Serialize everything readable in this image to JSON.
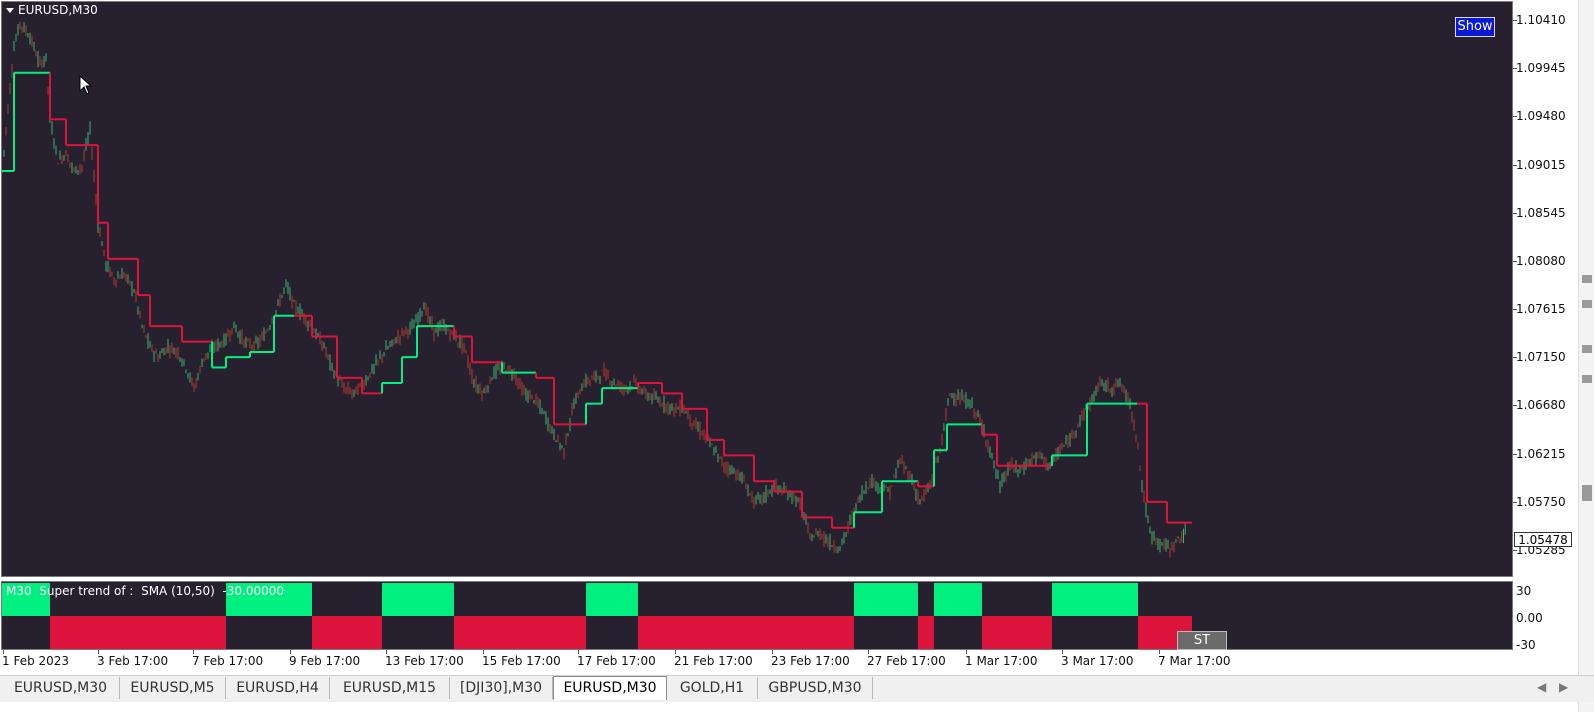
{
  "window": {
    "title": "EURUSD,M30",
    "show_button": "Show",
    "indicator_label": "M30  Super trend of :  SMA (10,50)  -30.00000",
    "st_button": "ST"
  },
  "price_axis": [
    "1.10410",
    "1.09945",
    "1.09480",
    "1.09015",
    "1.08545",
    "1.08080",
    "1.07615",
    "1.07150",
    "1.06680",
    "1.06215",
    "1.05750",
    "1.05285"
  ],
  "current_price": "1.05478",
  "sub_axis": [
    "30",
    "0.00",
    "-30"
  ],
  "time_axis": [
    "1 Feb 2023",
    "3 Feb 17:00",
    "7 Feb 17:00",
    "9 Feb 17:00",
    "13 Feb 17:00",
    "15 Feb 17:00",
    "17 Feb 17:00",
    "21 Feb 17:00",
    "23 Feb 17:00",
    "27 Feb 17:00",
    "1 Mar 17:00",
    "3 Mar 17:00",
    "7 Mar 17:00"
  ],
  "tabs": [
    {
      "label": "EURUSD,M30",
      "active": false
    },
    {
      "label": "EURUSD,M5",
      "active": false
    },
    {
      "label": "EURUSD,H4",
      "active": false
    },
    {
      "label": "EURUSD,M15",
      "active": false
    },
    {
      "label": "[DJI30],M30",
      "active": false
    },
    {
      "label": "EURUSD,M30",
      "active": true
    },
    {
      "label": "GOLD,H1",
      "active": false
    },
    {
      "label": "GBPUSD,M30",
      "active": false
    }
  ],
  "colors": {
    "background": "#27212f",
    "bull": "#00f080",
    "bear": "#dc143c",
    "candle_up": "#3cb371",
    "candle_down": "#b03a2e"
  },
  "chart_data": {
    "type": "line",
    "series": [
      {
        "values": [
          [
            0,
            1.0895
          ],
          [
            12,
            1.1015
          ],
          [
            18,
            1.1038
          ],
          [
            28,
            1.1025
          ],
          [
            38,
            1.0998
          ],
          [
            44,
            1.1005
          ],
          [
            48,
            1.0945
          ],
          [
            56,
            1.0905
          ],
          [
            64,
            1.0912
          ],
          [
            72,
            1.0895
          ],
          [
            80,
            1.09
          ],
          [
            88,
            1.0935
          ],
          [
            96,
            1.0845
          ],
          [
            104,
            1.0805
          ],
          [
            112,
            1.079
          ],
          [
            122,
            1.0795
          ],
          [
            132,
            1.078
          ],
          [
            140,
            1.0745
          ],
          [
            148,
            1.0725
          ],
          [
            156,
            1.0715
          ],
          [
            166,
            1.0725
          ],
          [
            176,
            1.072
          ],
          [
            184,
            1.0705
          ],
          [
            192,
            1.0685
          ],
          [
            202,
            1.0715
          ],
          [
            212,
            1.0725
          ],
          [
            222,
            1.073
          ],
          [
            232,
            1.0745
          ],
          [
            242,
            1.073
          ],
          [
            252,
            1.0725
          ],
          [
            262,
            1.0735
          ],
          [
            272,
            1.0755
          ],
          [
            284,
            1.0785
          ],
          [
            292,
            1.0765
          ],
          [
            302,
            1.0755
          ],
          [
            312,
            1.074
          ],
          [
            322,
            1.0725
          ],
          [
            332,
            1.07
          ],
          [
            342,
            1.0685
          ],
          [
            352,
            1.068
          ],
          [
            362,
            1.069
          ],
          [
            372,
            1.0705
          ],
          [
            382,
            1.072
          ],
          [
            392,
            1.073
          ],
          [
            402,
            1.074
          ],
          [
            412,
            1.0745
          ],
          [
            422,
            1.0765
          ],
          [
            432,
            1.074
          ],
          [
            442,
            1.0745
          ],
          [
            452,
            1.0735
          ],
          [
            462,
            1.0725
          ],
          [
            472,
            1.069
          ],
          [
            482,
            1.068
          ],
          [
            492,
            1.07
          ],
          [
            502,
            1.0705
          ],
          [
            512,
            1.07
          ],
          [
            522,
            1.068
          ],
          [
            532,
            1.0675
          ],
          [
            542,
            1.066
          ],
          [
            552,
            1.064
          ],
          [
            562,
            1.0625
          ],
          [
            572,
            1.067
          ],
          [
            582,
            1.069
          ],
          [
            592,
            1.0695
          ],
          [
            602,
            1.07
          ],
          [
            612,
            1.069
          ],
          [
            622,
            1.0685
          ],
          [
            632,
            1.069
          ],
          [
            642,
            1.068
          ],
          [
            652,
            1.0675
          ],
          [
            662,
            1.067
          ],
          [
            672,
            1.0665
          ],
          [
            682,
            1.0665
          ],
          [
            692,
            1.065
          ],
          [
            702,
            1.064
          ],
          [
            712,
            1.0625
          ],
          [
            722,
            1.061
          ],
          [
            732,
            1.0605
          ],
          [
            742,
            1.0595
          ],
          [
            752,
            1.0575
          ],
          [
            762,
            1.058
          ],
          [
            772,
            1.059
          ],
          [
            782,
            1.0585
          ],
          [
            792,
            1.058
          ],
          [
            800,
            1.057
          ],
          [
            808,
            1.054
          ],
          [
            818,
            1.0545
          ],
          [
            828,
            1.0535
          ],
          [
            838,
            1.053
          ],
          [
            848,
            1.0555
          ],
          [
            858,
            1.058
          ],
          [
            868,
            1.0595
          ],
          [
            878,
            1.059
          ],
          [
            888,
            1.0585
          ],
          [
            898,
            1.0615
          ],
          [
            908,
            1.06
          ],
          [
            918,
            1.0575
          ],
          [
            928,
            1.059
          ],
          [
            938,
            1.0625
          ],
          [
            948,
            1.068
          ],
          [
            958,
            1.0675
          ],
          [
            968,
            1.067
          ],
          [
            978,
            1.0655
          ],
          [
            988,
            1.0625
          ],
          [
            998,
            1.059
          ],
          [
            1008,
            1.061
          ],
          [
            1018,
            1.0605
          ],
          [
            1028,
            1.0615
          ],
          [
            1038,
            1.062
          ],
          [
            1048,
            1.061
          ],
          [
            1058,
            1.0625
          ],
          [
            1068,
            1.0635
          ],
          [
            1078,
            1.0655
          ],
          [
            1088,
            1.067
          ],
          [
            1098,
            1.069
          ],
          [
            1108,
            1.0685
          ],
          [
            1118,
            1.069
          ],
          [
            1128,
            1.067
          ],
          [
            1136,
            1.063
          ],
          [
            1140,
            1.059
          ],
          [
            1148,
            1.0545
          ],
          [
            1158,
            1.0535
          ],
          [
            1168,
            1.053
          ],
          [
            1178,
            1.054
          ],
          [
            1185,
            1.0548
          ]
        ]
      }
    ],
    "supertrend": [
      {
        "from": 0,
        "to": 12,
        "trend": "up",
        "level": 1.0895
      },
      {
        "from": 12,
        "to": 48,
        "trend": "up",
        "level": 1.099
      },
      {
        "from": 48,
        "to": 64,
        "trend": "down",
        "level": 1.0945
      },
      {
        "from": 64,
        "to": 96,
        "trend": "down",
        "level": 1.092
      },
      {
        "from": 96,
        "to": 106,
        "trend": "down",
        "level": 1.0845
      },
      {
        "from": 106,
        "to": 136,
        "trend": "down",
        "level": 1.081
      },
      {
        "from": 136,
        "to": 148,
        "trend": "down",
        "level": 1.0775
      },
      {
        "from": 148,
        "to": 180,
        "trend": "down",
        "level": 1.0745
      },
      {
        "from": 180,
        "to": 210,
        "trend": "down",
        "level": 1.073
      },
      {
        "from": 210,
        "to": 224,
        "trend": "up",
        "level": 1.0705
      },
      {
        "from": 224,
        "to": 248,
        "trend": "up",
        "level": 1.0715
      },
      {
        "from": 248,
        "to": 272,
        "trend": "up",
        "level": 1.072
      },
      {
        "from": 272,
        "to": 292,
        "trend": "up",
        "level": 1.0755
      },
      {
        "from": 292,
        "to": 310,
        "trend": "down",
        "level": 1.0755
      },
      {
        "from": 310,
        "to": 335,
        "trend": "down",
        "level": 1.0735
      },
      {
        "from": 335,
        "to": 360,
        "trend": "down",
        "level": 1.0695
      },
      {
        "from": 360,
        "to": 380,
        "trend": "down",
        "level": 1.068
      },
      {
        "from": 380,
        "to": 400,
        "trend": "up",
        "level": 1.069
      },
      {
        "from": 400,
        "to": 415,
        "trend": "up",
        "level": 1.0715
      },
      {
        "from": 415,
        "to": 452,
        "trend": "up",
        "level": 1.0745
      },
      {
        "from": 452,
        "to": 470,
        "trend": "down",
        "level": 1.0735
      },
      {
        "from": 470,
        "to": 500,
        "trend": "down",
        "level": 1.071
      },
      {
        "from": 500,
        "to": 534,
        "trend": "up",
        "level": 1.07
      },
      {
        "from": 534,
        "to": 552,
        "trend": "down",
        "level": 1.0695
      },
      {
        "from": 552,
        "to": 584,
        "trend": "down",
        "level": 1.065
      },
      {
        "from": 584,
        "to": 600,
        "trend": "up",
        "level": 1.067
      },
      {
        "from": 600,
        "to": 636,
        "trend": "up",
        "level": 1.0685
      },
      {
        "from": 636,
        "to": 660,
        "trend": "down",
        "level": 1.069
      },
      {
        "from": 660,
        "to": 680,
        "trend": "down",
        "level": 1.068
      },
      {
        "from": 680,
        "to": 705,
        "trend": "down",
        "level": 1.0665
      },
      {
        "from": 705,
        "to": 722,
        "trend": "down",
        "level": 1.0635
      },
      {
        "from": 722,
        "to": 752,
        "trend": "down",
        "level": 1.062
      },
      {
        "from": 752,
        "to": 772,
        "trend": "down",
        "level": 1.0595
      },
      {
        "from": 772,
        "to": 800,
        "trend": "down",
        "level": 1.0585
      },
      {
        "from": 800,
        "to": 830,
        "trend": "down",
        "level": 1.056
      },
      {
        "from": 830,
        "to": 852,
        "trend": "down",
        "level": 1.055
      },
      {
        "from": 852,
        "to": 880,
        "trend": "up",
        "level": 1.0565
      },
      {
        "from": 880,
        "to": 916,
        "trend": "up",
        "level": 1.0595
      },
      {
        "from": 916,
        "to": 932,
        "trend": "down",
        "level": 1.059
      },
      {
        "from": 932,
        "to": 945,
        "trend": "up",
        "level": 1.0625
      },
      {
        "from": 945,
        "to": 980,
        "trend": "up",
        "level": 1.065
      },
      {
        "from": 980,
        "to": 995,
        "trend": "down",
        "level": 1.064
      },
      {
        "from": 995,
        "to": 1050,
        "trend": "down",
        "level": 1.061
      },
      {
        "from": 1050,
        "to": 1085,
        "trend": "up",
        "level": 1.062
      },
      {
        "from": 1085,
        "to": 1135,
        "trend": "up",
        "level": 1.067
      },
      {
        "from": 1135,
        "to": 1145,
        "trend": "down",
        "level": 1.067
      },
      {
        "from": 1145,
        "to": 1165,
        "trend": "down",
        "level": 1.0575
      },
      {
        "from": 1165,
        "to": 1190,
        "trend": "down",
        "level": 1.0555
      }
    ],
    "histogram": [
      {
        "from": 0,
        "to": 48,
        "trend": "up"
      },
      {
        "from": 48,
        "to": 224,
        "trend": "down"
      },
      {
        "from": 224,
        "to": 310,
        "trend": "up"
      },
      {
        "from": 310,
        "to": 380,
        "trend": "down"
      },
      {
        "from": 380,
        "to": 452,
        "trend": "up"
      },
      {
        "from": 452,
        "to": 584,
        "trend": "down"
      },
      {
        "from": 584,
        "to": 636,
        "trend": "up"
      },
      {
        "from": 636,
        "to": 852,
        "trend": "down"
      },
      {
        "from": 852,
        "to": 916,
        "trend": "up"
      },
      {
        "from": 916,
        "to": 932,
        "trend": "down"
      },
      {
        "from": 932,
        "to": 980,
        "trend": "up"
      },
      {
        "from": 980,
        "to": 1050,
        "trend": "down"
      },
      {
        "from": 1050,
        "to": 1136,
        "trend": "up"
      },
      {
        "from": 1136,
        "to": 1190,
        "trend": "down"
      }
    ],
    "ylim": [
      1.051,
      1.1055
    ]
  }
}
